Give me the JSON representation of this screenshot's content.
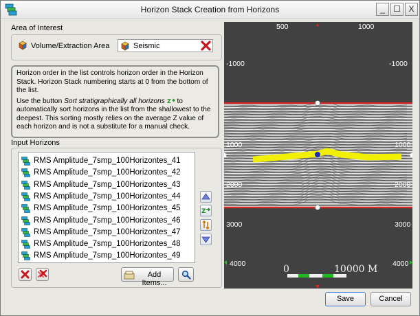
{
  "window": {
    "title": "Horizon Stack Creation from Horizons",
    "minimize_glyph": "_",
    "maximize_glyph": "☐",
    "close_glyph": "X"
  },
  "area_of_interest": {
    "heading": "Area of Interest",
    "label": "Volume/Extraction Area",
    "value": "Seismic"
  },
  "info": {
    "p1": "Horizon order in the list controls horizon order in the Horizon Stack. Horizon Stack numbering starts at 0 from the bottom of the list.",
    "p2_before": "Use the button ",
    "p2_italic": "Sort stratigraphically all horizons",
    "p2_after": " to automatically sort horizons in the list from the shallowest to the deepest. This sorting mostly relies on the average Z value of each horizon and is not a substitute for a manual check."
  },
  "input_horizons": {
    "heading": "Input Horizons",
    "items": [
      "RMS Amplitude_7smp_100Horizontes_41",
      "RMS Amplitude_7smp_100Horizontes_42",
      "RMS Amplitude_7smp_100Horizontes_43",
      "RMS Amplitude_7smp_100Horizontes_44",
      "RMS Amplitude_7smp_100Horizontes_45",
      "RMS Amplitude_7smp_100Horizontes_46",
      "RMS Amplitude_7smp_100Horizontes_47",
      "RMS Amplitude_7smp_100Horizontes_48",
      "RMS Amplitude_7smp_100Horizontes_49"
    ],
    "add_items_label": "Add Items..."
  },
  "seismic_view": {
    "top_labels": [
      "500",
      "1000"
    ],
    "left_labels": [
      "-1000",
      "1000",
      "2000",
      "3000",
      "4000"
    ],
    "right_labels": [
      "-1000",
      "1000",
      "2000",
      "3000",
      "4000"
    ],
    "scale_start": "0",
    "scale_end": "10000 M",
    "horizon_color": "#f0f000",
    "boundary_color": "#d32a2a"
  },
  "footer": {
    "save_label": "Save",
    "cancel_label": "Cancel"
  }
}
